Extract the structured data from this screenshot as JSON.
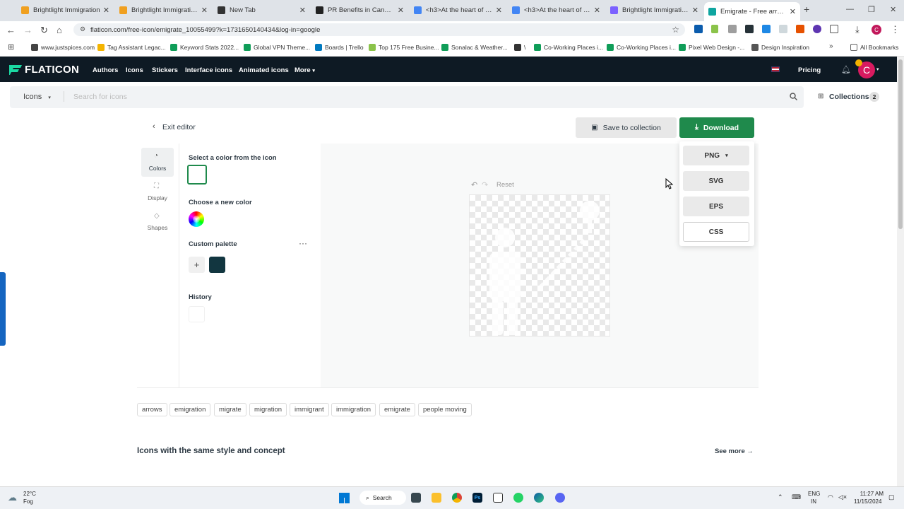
{
  "browser": {
    "tabs": [
      {
        "title": "Brightlight Immigration",
        "fav": "#f0a020"
      },
      {
        "title": "Brightlight Immigration - ",
        "fav": "#f0a020"
      },
      {
        "title": "New Tab",
        "fav": "#333333"
      },
      {
        "title": "PR Benefits in Canada",
        "fav": "#222222"
      },
      {
        "title": "<h3>At the heart of Canada",
        "fav": "#4285f4"
      },
      {
        "title": "<h3>At the heart of Canada",
        "fav": "#4285f4"
      },
      {
        "title": "Brightlight Immigration - ",
        "fav": "#7b61ff"
      },
      {
        "title": "Emigrate - Free arrows ico",
        "fav": "#0fa5a0"
      }
    ],
    "url": "flaticon.com/free-icon/emigrate_10055499?k=1731650140434&log-in=google",
    "bookmarks": [
      {
        "label": "www.justspices.com",
        "color": "#444"
      },
      {
        "label": "Tag Assistant Legac...",
        "color": "#f4b400"
      },
      {
        "label": "Keyword Stats 2022...",
        "color": "#0f9d58"
      },
      {
        "label": "Global VPN Theme...",
        "color": "#0f9d58"
      },
      {
        "label": "Boards | Trello",
        "color": "#0079bf"
      },
      {
        "label": "Top 175 Free Busine...",
        "color": "#8bc34a"
      },
      {
        "label": "Sonalac & Weather...",
        "color": "#0f9d58"
      },
      {
        "label": "\\",
        "color": "#333"
      },
      {
        "label": "Co-Working Places i...",
        "color": "#0f9d58"
      },
      {
        "label": "Co-Working Places i...",
        "color": "#0f9d58"
      },
      {
        "label": "Pixel Web Design -...",
        "color": "#0f9d58"
      },
      {
        "label": "Design Inspiration",
        "color": "#555"
      }
    ],
    "all_bookmarks": "All Bookmarks"
  },
  "site": {
    "logo": "FLATICON",
    "nav": [
      "Authors",
      "Icons",
      "Stickers",
      "Interface icons",
      "Animated icons",
      "More"
    ],
    "pricing": "Pricing",
    "avatar_letter": "C",
    "search": {
      "category": "Icons",
      "placeholder": "Search for icons"
    },
    "collections": {
      "label": "Collections",
      "count": "2"
    }
  },
  "editor": {
    "exit": "Exit editor",
    "save": "Save to collection",
    "download": "Download",
    "formats": [
      "PNG",
      "SVG",
      "EPS",
      "CSS"
    ],
    "sidebar": [
      "Colors",
      "Display",
      "Shapes"
    ],
    "select_color": "Select a color from the icon",
    "choose_color": "Choose a new color",
    "custom_palette": "Custom palette",
    "history": "History",
    "reset": "Reset",
    "palette_color": "#123640",
    "accent": "#1f8a4c"
  },
  "tags": [
    "arrows",
    "emigration",
    "migrate",
    "migration",
    "immigrant",
    "immigration",
    "emigrate",
    "people moving"
  ],
  "related": {
    "title": "Icons with the same style and concept",
    "see_more": "See more"
  },
  "taskbar": {
    "weather_temp": "22°C",
    "weather_desc": "Fog",
    "search": "Search",
    "lang": "ENG",
    "region": "IN",
    "time": "11:27 AM",
    "date": "11/15/2024"
  }
}
